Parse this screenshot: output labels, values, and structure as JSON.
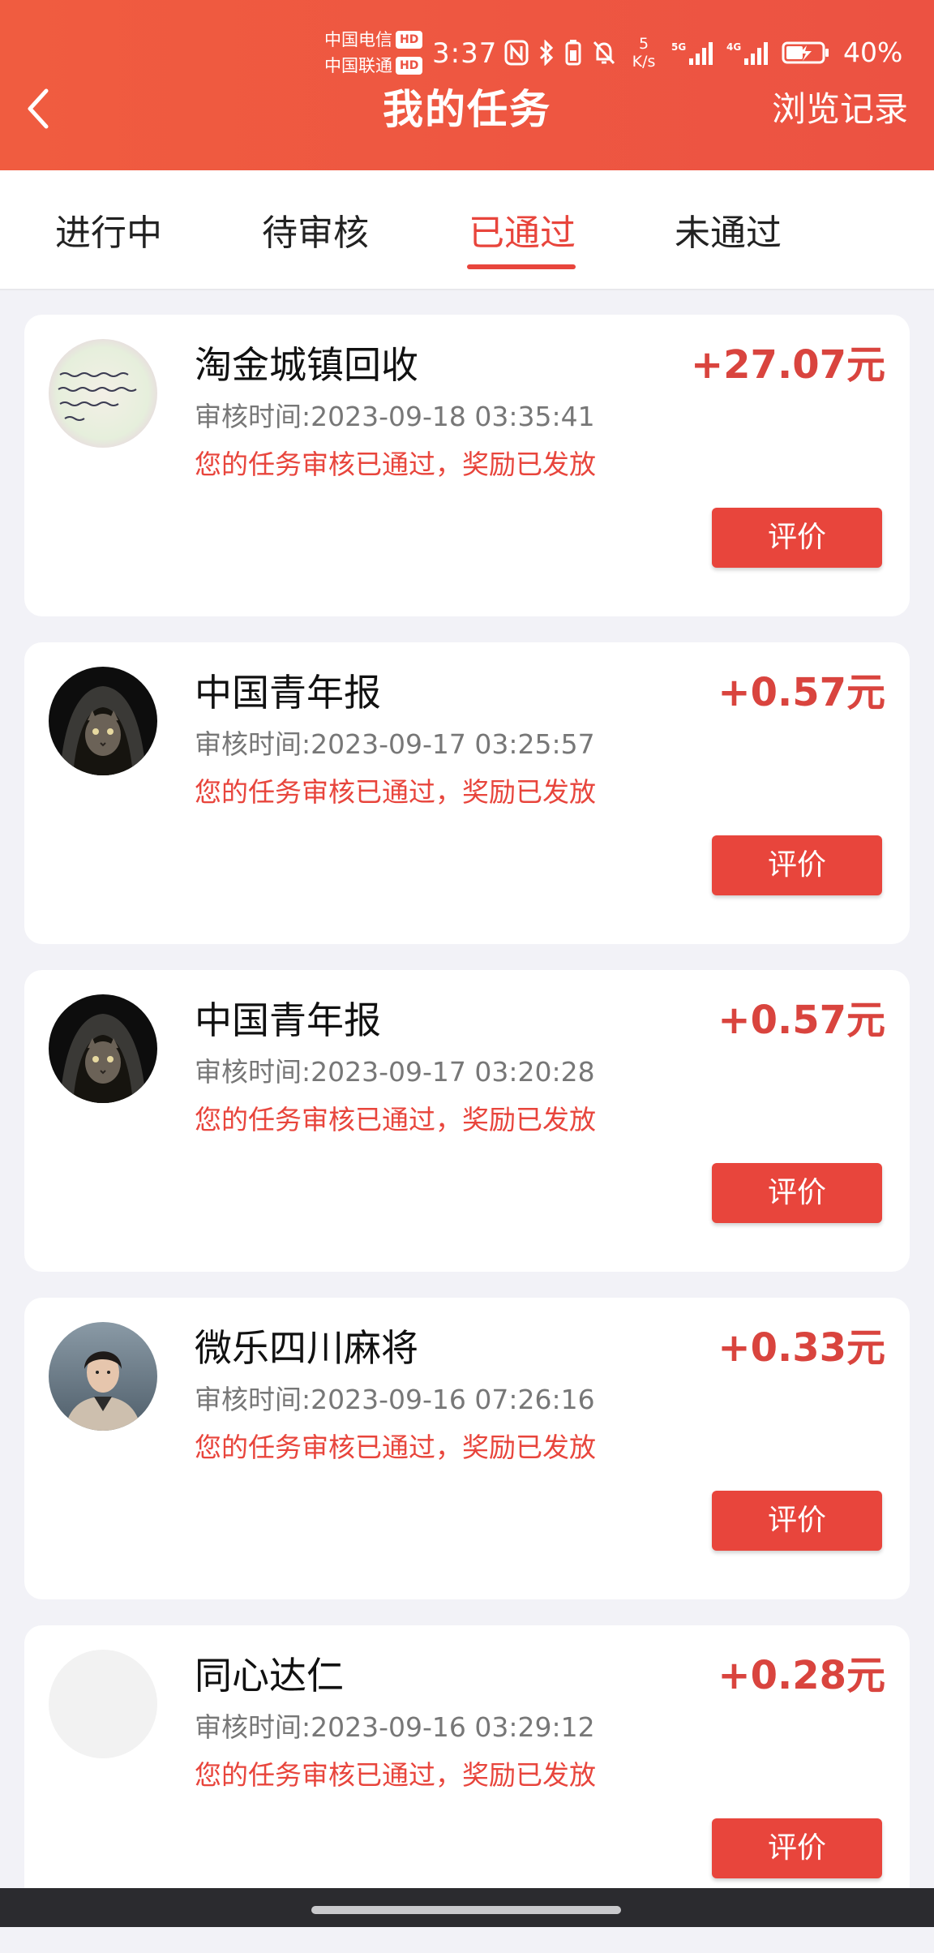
{
  "status_bar": {
    "carrier_1": "中国电信",
    "carrier_2": "中国联通",
    "hd_badge": "HD",
    "time": "3:37",
    "net_speed_value": "5",
    "net_speed_unit": "K/s",
    "signal_1_label": "5G",
    "signal_2_label": "4G",
    "battery_percent": "40%"
  },
  "header": {
    "title": "我的任务",
    "history_link": "浏览记录",
    "back_icon": "chevron-left-icon"
  },
  "tabs": [
    {
      "label": "进行中"
    },
    {
      "label": "待审核"
    },
    {
      "label": "已通过"
    },
    {
      "label": "未通过"
    }
  ],
  "active_tab": "已通过",
  "tasks": [
    {
      "name": "淘金城镇回收",
      "reward": "+27.07元",
      "review_time": "审核时间:2023-09-18 03:35:41",
      "status": "您的任务审核已通过，奖励已发放",
      "button": "评价",
      "avatar": "handwriting-note-avatar"
    },
    {
      "name": "中国青年报",
      "reward": "+0.57元",
      "review_time": "审核时间:2023-09-17 03:25:57",
      "status": "您的任务审核已通过，奖励已发放",
      "button": "评价",
      "avatar": "hooded-cat-avatar"
    },
    {
      "name": "中国青年报",
      "reward": "+0.57元",
      "review_time": "审核时间:2023-09-17 03:20:28",
      "status": "您的任务审核已通过，奖励已发放",
      "button": "评价",
      "avatar": "hooded-cat-avatar"
    },
    {
      "name": "微乐四川麻将",
      "reward": "+0.33元",
      "review_time": "审核时间:2023-09-16 07:26:16",
      "status": "您的任务审核已通过，奖励已发放",
      "button": "评价",
      "avatar": "young-man-avatar"
    },
    {
      "name": "同心达仁",
      "reward": "+0.28元",
      "review_time": "审核时间:2023-09-16 03:29:12",
      "status": "您的任务审核已通过，奖励已发放",
      "button": "评价",
      "avatar": "blank-avatar"
    }
  ],
  "colors": {
    "header_bg": "#ec5242",
    "accent": "#e8453c",
    "reward": "#d9443e",
    "page_bg": "#f2f2f7"
  }
}
